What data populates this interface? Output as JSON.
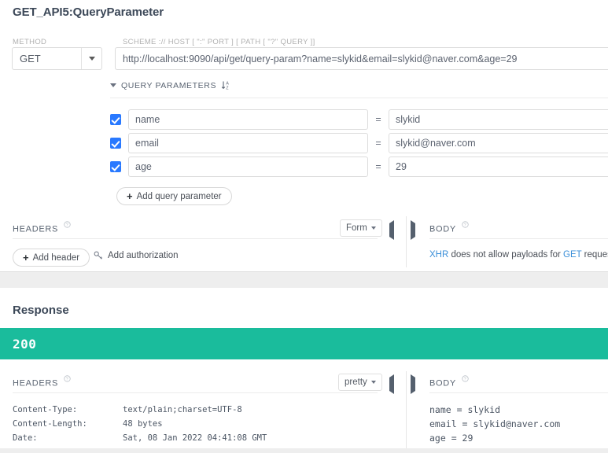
{
  "request": {
    "title": "GET_API5:QueryParameter",
    "method_label": "METHOD",
    "method_value": "GET",
    "url_label": "SCHEME :// HOST [ \":\" PORT ] [ PATH [ \"?\" QUERY ]]",
    "url_value": "http://localhost:9090/api/get/query-param?name=slykid&email=slykid@naver.com&age=29",
    "query_params": {
      "section_label": "QUERY PARAMETERS",
      "sort_icon": "sort-az-icon",
      "rows": [
        {
          "enabled": true,
          "key": "name",
          "eq": "=",
          "value": "slykid"
        },
        {
          "enabled": true,
          "key": "email",
          "eq": "=",
          "value": "slykid@naver.com"
        },
        {
          "enabled": true,
          "key": "age",
          "eq": "=",
          "value": "29"
        }
      ],
      "add_label": "Add query parameter",
      "add_icon": "plus-icon"
    },
    "headers": {
      "label": "HEADERS",
      "help_icon": "question-circle-icon",
      "view_mode": "Form",
      "collapse_left_icon": "triangle-left-icon",
      "collapse_right_icon": "triangle-right-icon",
      "add_header_label": "Add header",
      "add_header_icon": "plus-icon",
      "add_auth_label": "Add authorization",
      "add_auth_icon": "key-icon"
    },
    "body": {
      "label": "BODY",
      "help_icon": "question-circle-icon",
      "note_prefix": "XHR",
      "note_middle": " does not allow payloads for ",
      "note_method": "GET",
      "note_suffix": " request."
    }
  },
  "response": {
    "title": "Response",
    "status_code": "200",
    "status_color": "#1abc9c",
    "headers": {
      "label": "HEADERS",
      "help_icon": "question-circle-icon",
      "rows": [
        {
          "name": "Content-Type:",
          "value": "text/plain;charset=UTF-8"
        },
        {
          "name": "Content-Length:",
          "value": "48 bytes"
        },
        {
          "name": "Date:",
          "value": "Sat, 08 Jan 2022 04:41:08 GMT"
        }
      ]
    },
    "body": {
      "label": "BODY",
      "help_icon": "question-circle-icon",
      "view_mode": "pretty",
      "collapse_left_icon": "triangle-left-icon",
      "collapse_right_icon": "triangle-right-icon",
      "content": "name = slykid\nemail = slykid@naver.com\nage = 29"
    }
  },
  "colors": {
    "accent_green": "#1abc9c",
    "checkbox_blue": "#2979ff",
    "link_blue": "#3b8fd8",
    "panel_bg": "#ffffff",
    "page_bg": "#eeeeee"
  }
}
